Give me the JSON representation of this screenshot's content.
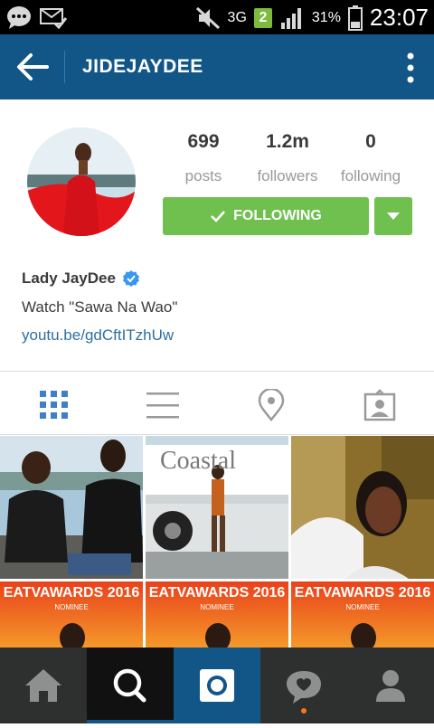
{
  "status_bar": {
    "network": "3G",
    "sim_badge": "2",
    "battery": "31%",
    "time": "23:07"
  },
  "header": {
    "title": "JIDEJAYDEE"
  },
  "profile": {
    "stats": [
      {
        "value": "699",
        "label": "posts"
      },
      {
        "value": "1.2m",
        "label": "followers"
      },
      {
        "value": "0",
        "label": "following"
      }
    ],
    "follow_button": "FOLLOWING",
    "name": "Lady JayDee",
    "bio": "Watch \"Sawa Na Wao\"",
    "link": "youtu.be/gdCftITzhUw"
  },
  "tabs": [
    "grid-view",
    "list-view",
    "location",
    "tagged"
  ],
  "grid": {
    "tile_text": {
      "coastal": "Coastal",
      "award_title": "EATVAWARDS 2016",
      "award_sub": "NOMINEE"
    }
  },
  "bottom_nav": [
    "home",
    "search",
    "camera",
    "activity",
    "profile"
  ],
  "colors": {
    "header_bg": "#125688",
    "follow_green": "#70c050",
    "link_blue": "#2b6fa6",
    "bottom_bg": "#2e3030",
    "active_blue": "#125688"
  }
}
